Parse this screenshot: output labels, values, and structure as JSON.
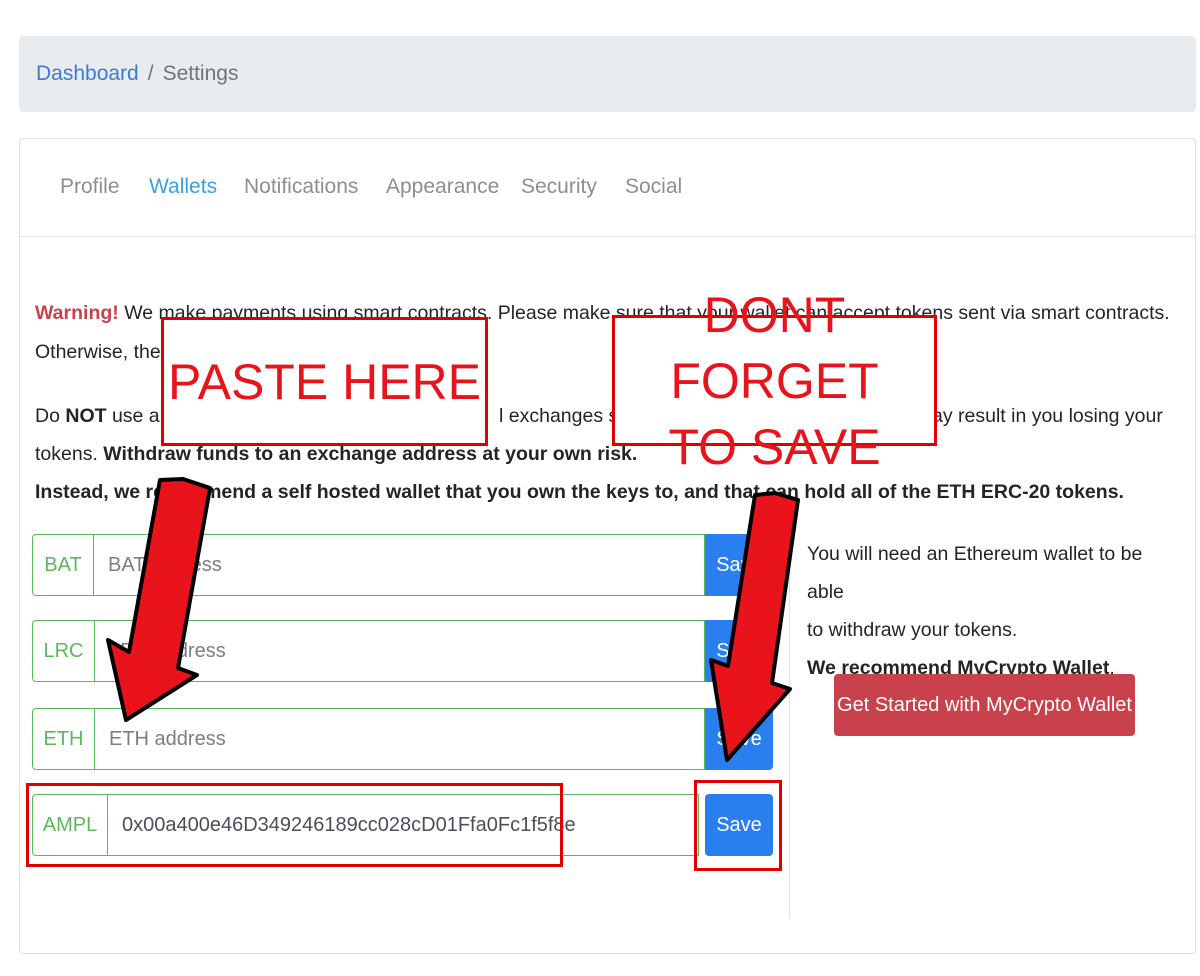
{
  "breadcrumb": {
    "link": "Dashboard",
    "separator": "/",
    "current": "Settings"
  },
  "tabs": [
    {
      "label": "Profile",
      "active": false
    },
    {
      "label": "Wallets",
      "active": true
    },
    {
      "label": "Notifications",
      "active": false
    },
    {
      "label": "Appearance",
      "active": false
    },
    {
      "label": "Security",
      "active": false
    },
    {
      "label": "Social",
      "active": false
    }
  ],
  "warning": {
    "label": "Warning!",
    "line1": "We make payments using smart contracts. Please make sure that your wallet can accept tokens sent via smart contracts.",
    "line2": "Otherwise, the t"
  },
  "notice": {
    "do": "Do",
    "not": "NOT",
    "line1_text": "use a w",
    "line1_mid": "l exchanges sup",
    "line1_end": "ay result in you losing your",
    "tokens": "tokens.",
    "withdraw_bold": "Withdraw funds to an exchange address at your own risk.",
    "recommend_bold": "Instead, we recommend a self hosted wallet that you own the keys to, and that can hold all of the ETH ERC-20 tokens."
  },
  "wallets": [
    {
      "token": "BAT",
      "placeholder": "BAT address",
      "value": "",
      "save_label": "Save"
    },
    {
      "token": "LRC",
      "placeholder": "LRC address",
      "value": "",
      "save_label": "Save"
    },
    {
      "token": "ETH",
      "placeholder": "ETH address",
      "value": "",
      "save_label": "Save"
    },
    {
      "token": "AMPL",
      "placeholder": "AMPL address",
      "value": "0x00a400e46D349246189cc028cD01Ffa0Fc1f5f8e",
      "save_label": "Save"
    }
  ],
  "sidebar": {
    "line1": "You will need an Ethereum wallet to be able",
    "line2": "to withdraw your tokens.",
    "recommend": "We recommend MyCrypto Wallet",
    "period": ".",
    "button": "Get Started with MyCrypto Wallet"
  },
  "annotations": {
    "paste_here": "PASTE HERE",
    "dont_forget_line1": "DONT FORGET",
    "dont_forget_line2": "TO SAVE"
  },
  "colors": {
    "accent_blue": "#2a7ff0",
    "tab_active": "#3aa0e0",
    "success_green": "#5cb85c",
    "danger_red": "#c9414a",
    "annotation_red": "#e00000"
  }
}
